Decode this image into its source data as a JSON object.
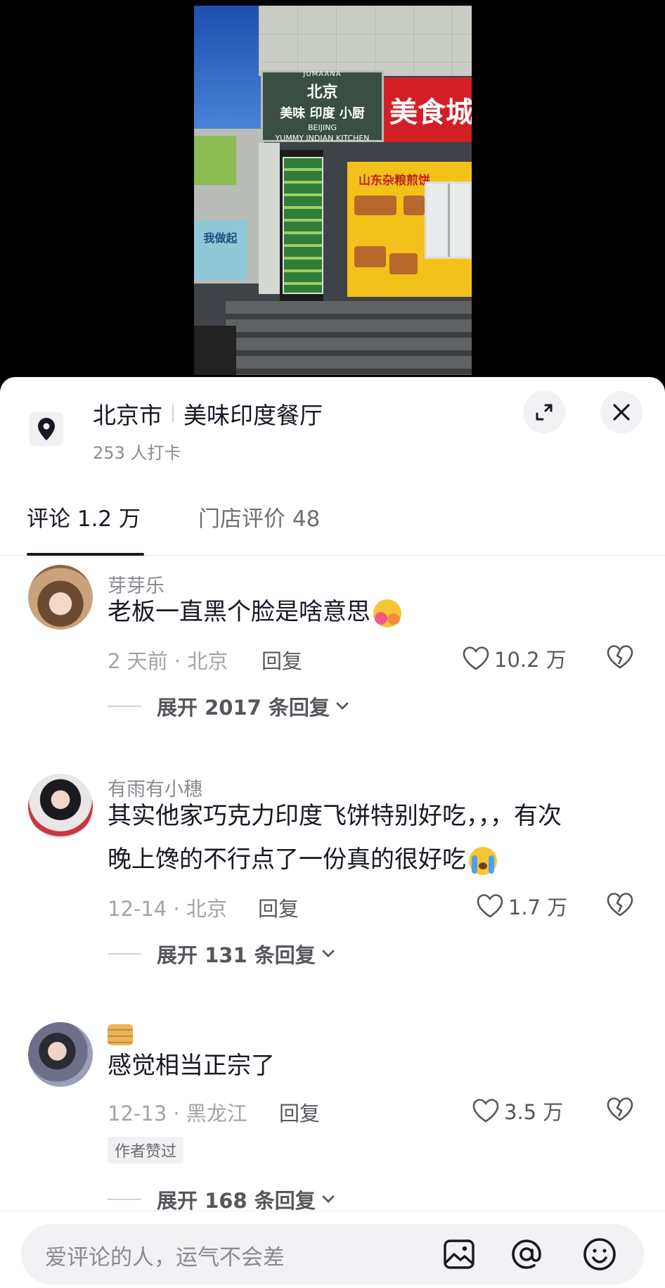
{
  "photo": {
    "sign_top": "JUMAANA",
    "sign_city": "北京",
    "sign_name": "美味 印度 小厨",
    "sign_en1": "BEIJING",
    "sign_en2": "YUMMY INDIAN KITCHEN",
    "sign_red": "美食城",
    "left_poster": "我做起",
    "stall_title": "山东杂粮煎饼"
  },
  "location": {
    "city": "北京市",
    "place": "美味印度餐厅",
    "checkins": "253 人打卡",
    "pin_icon": "location-pin-icon",
    "expand_icon": "expand-icon",
    "close_icon": "close-icon"
  },
  "tabs": [
    {
      "label": "评论 1.2 万",
      "active": true
    },
    {
      "label": "门店评价 48",
      "active": false
    }
  ],
  "comments": [
    {
      "username": "芽芽乐",
      "text": "老板一直黑个脸是啥意思",
      "emoji": "hugging-face-emoji",
      "time_location": "2 天前 · 北京",
      "reply_label": "回复",
      "likes": "10.2 万",
      "expand_label": "展开 2017 条回复"
    },
    {
      "username": "有雨有小穗",
      "text_line1": "其实他家巧克力印度飞饼特别好吃，，，有次",
      "text_line2": "晚上馋的不行点了一份真的很好吃",
      "emoji": "crying-face-emoji",
      "time_location": "12-14 · 北京",
      "reply_label": "回复",
      "likes": "1.7 万",
      "expand_label": "展开 131 条回复"
    },
    {
      "username_emoji": "pancakes-emoji",
      "text": "感觉相当正宗了",
      "time_location": "12-13 · 黑龙江",
      "reply_label": "回复",
      "likes": "3.5 万",
      "badge": "作者赞过",
      "expand_label": "展开 168 条回复"
    }
  ],
  "input": {
    "placeholder": "爱评论的人，运气不会差",
    "image_icon": "image-icon",
    "mention_icon": "at-mention-icon",
    "emoji_icon": "emoji-icon"
  },
  "colors": {
    "text_primary": "#161823",
    "text_secondary": "#8a8b91",
    "sheet_bg": "#ffffff",
    "input_bg": "#f2f2f4"
  }
}
